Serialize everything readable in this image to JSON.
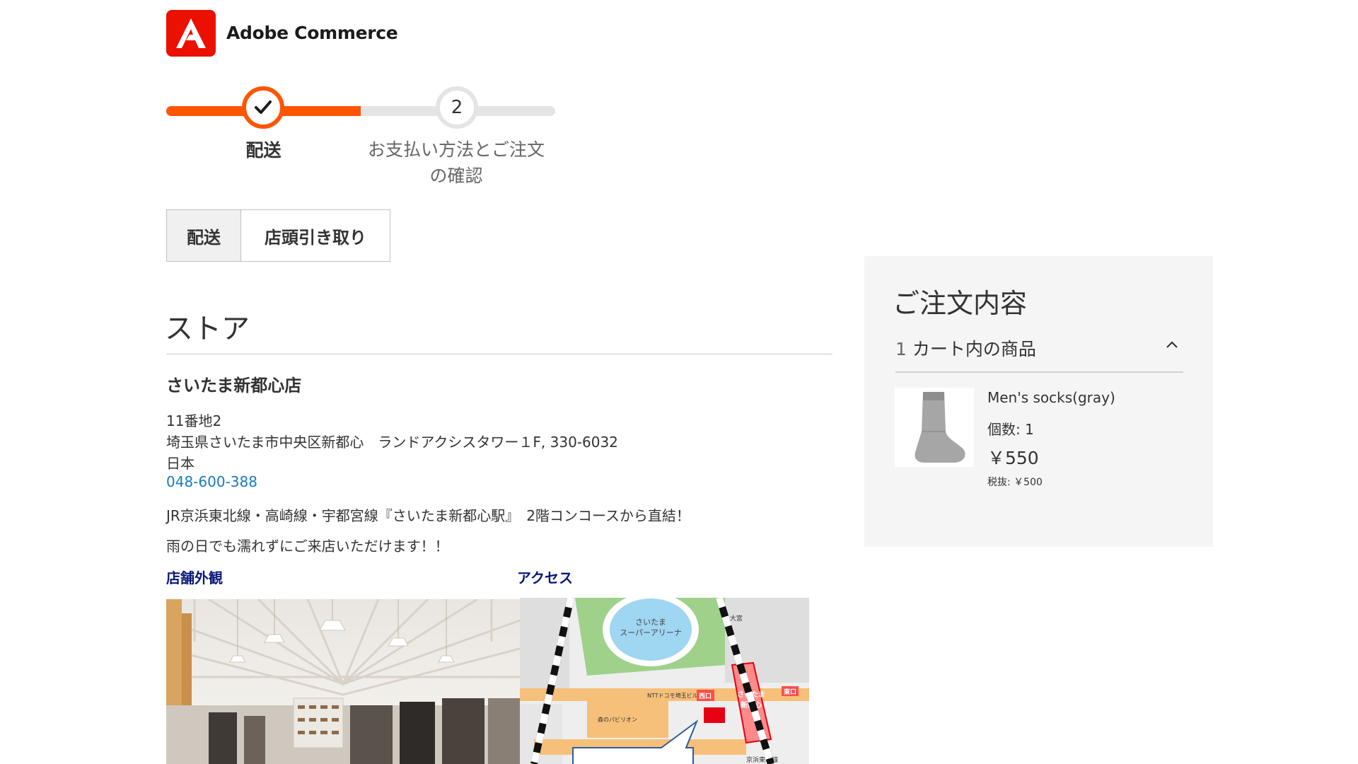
{
  "brand": {
    "name": "Adobe Commerce",
    "color": "#eb1000"
  },
  "progress": {
    "steps": [
      {
        "number": "1",
        "label": "配送",
        "state": "complete"
      },
      {
        "number": "2",
        "label_line1": "お支払い方法とご注文",
        "label_line2": "の確認",
        "state": "upcoming"
      }
    ],
    "accent_color": "#ff5501"
  },
  "shipping_tabs": [
    {
      "label": "配送",
      "selected": true
    },
    {
      "label": "店頭引き取り",
      "selected": false
    }
  ],
  "store": {
    "section_title": "ストア",
    "name": "さいたま新都心店",
    "address_line1": "11番地2",
    "address_line2": "埼玉県さいたま市中央区新都心　ランドアクシスタワー１F, 330-6032",
    "address_line3": "日本",
    "phone": "048-600-388",
    "note1": "JR京浜東北線・高崎線・宇都宮線『さいたま新都心駅』　2階コンコースから直結！",
    "note2": "雨の日でも濡れずにご来店いただけます！！",
    "exterior_heading": "店舗外観",
    "access_heading": "アクセス"
  },
  "map": {
    "labels": {
      "arena": "さいたま\nスーパーアリーナ",
      "station": "さいたま\n新都心",
      "west_exit": "西口",
      "east_exit": "東口",
      "omiya": "至 大宮",
      "ntt": "NTTドコモ埼玉ビル",
      "pavilion": "森のパビリオン",
      "keihin": "京浜東北線"
    }
  },
  "summary": {
    "title": "ご注文内容",
    "cart_count": "1",
    "cart_label": "カート内の商品",
    "expanded": true,
    "items": [
      {
        "name": "Men's socks(gray)",
        "qty_text": "個数: 1",
        "price": "￥550",
        "tax_text": "税抜: ￥500"
      }
    ]
  }
}
